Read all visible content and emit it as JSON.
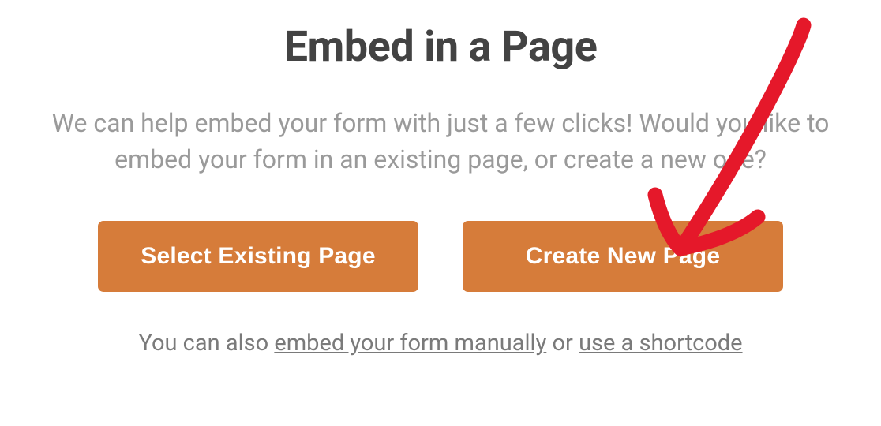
{
  "title": "Embed in a Page",
  "description": "We can help embed your form with just a few clicks! Would you like to embed your form in an existing page, or create a new one?",
  "buttons": {
    "existing": "Select Existing Page",
    "create": "Create New Page"
  },
  "footer": {
    "before": "You can also ",
    "linkManual": "embed your form manually",
    "middle": " or ",
    "linkShortcode": "use a shortcode"
  },
  "colors": {
    "accent": "#d67c3a",
    "annotation": "#e5182a"
  }
}
